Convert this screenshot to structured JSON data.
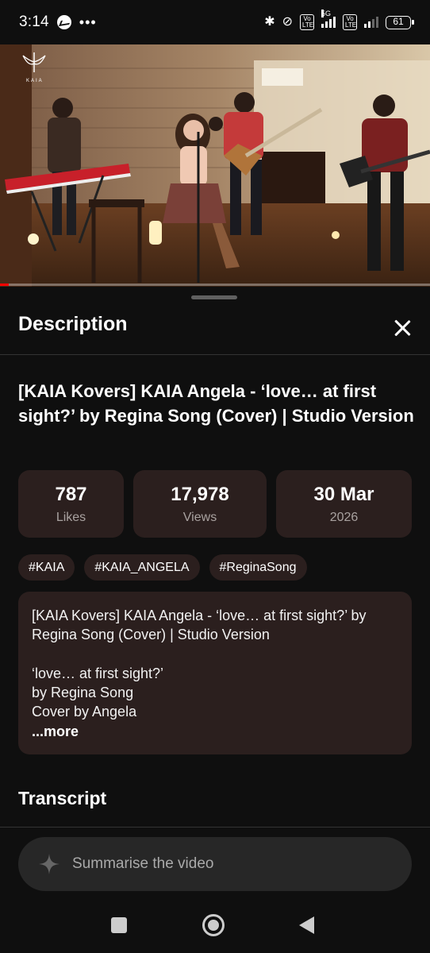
{
  "status_bar": {
    "time": "3:14",
    "battery": "61",
    "network_label": "5G",
    "volte_label": "Vo LTE"
  },
  "video": {
    "logo_text": "KAIA",
    "progress_fraction": 0.02
  },
  "sheet": {
    "title": "Description",
    "video_title": "[KAIA Kovers] KAIA Angela - ‘love… at first sight?’ by Regina Song (Cover) | Studio Version",
    "stats": [
      {
        "value": "787",
        "label": "Likes"
      },
      {
        "value": "17,978",
        "label": "Views"
      },
      {
        "value": "30 Mar",
        "label": "2026"
      }
    ],
    "tags": [
      "#KAIA",
      "#KAIA_ANGELA",
      "#ReginaSong"
    ],
    "description_lines": [
      "[KAIA Kovers] KAIA Angela - ‘love… at first sight?’ by",
      "Regina Song (Cover) | Studio Version",
      "",
      "‘love… at first sight?’",
      "by Regina Song",
      "Cover by Angela"
    ],
    "more_label": "...more",
    "transcript_title": "Transcript",
    "summarise_placeholder": "Summarise the video"
  },
  "colors": {
    "background": "#0f0f0f",
    "card": "#2b1f1e",
    "progress": "#ff0000",
    "input_bg": "#272727"
  }
}
